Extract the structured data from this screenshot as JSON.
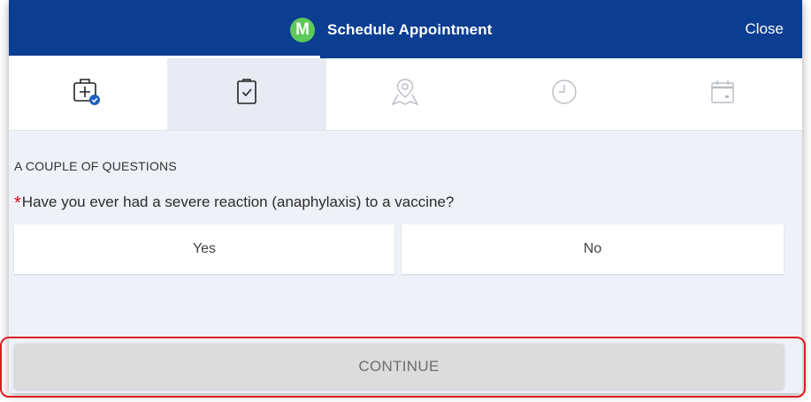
{
  "header": {
    "avatar_letter": "M",
    "title": "Schedule Appointment",
    "close_label": "Close",
    "background_color": "#0b3d91",
    "avatar_color": "#5cc95a"
  },
  "steps": [
    {
      "icon": "medical-kit-check-icon",
      "state": "completed"
    },
    {
      "icon": "clipboard-check-icon",
      "state": "active"
    },
    {
      "icon": "map-location-icon",
      "state": "upcoming"
    },
    {
      "icon": "clock-icon",
      "state": "upcoming"
    },
    {
      "icon": "calendar-icon",
      "state": "upcoming"
    }
  ],
  "questions": {
    "section_label": "A COUPLE OF QUESTIONS",
    "required_marker": "*",
    "question_text": "Have you ever had a severe reaction (anaphylaxis) to a vaccine?",
    "options": {
      "yes": "Yes",
      "no": "No"
    }
  },
  "footer": {
    "continue_label": "CONTINUE",
    "highlight_color": "#e0191f"
  }
}
